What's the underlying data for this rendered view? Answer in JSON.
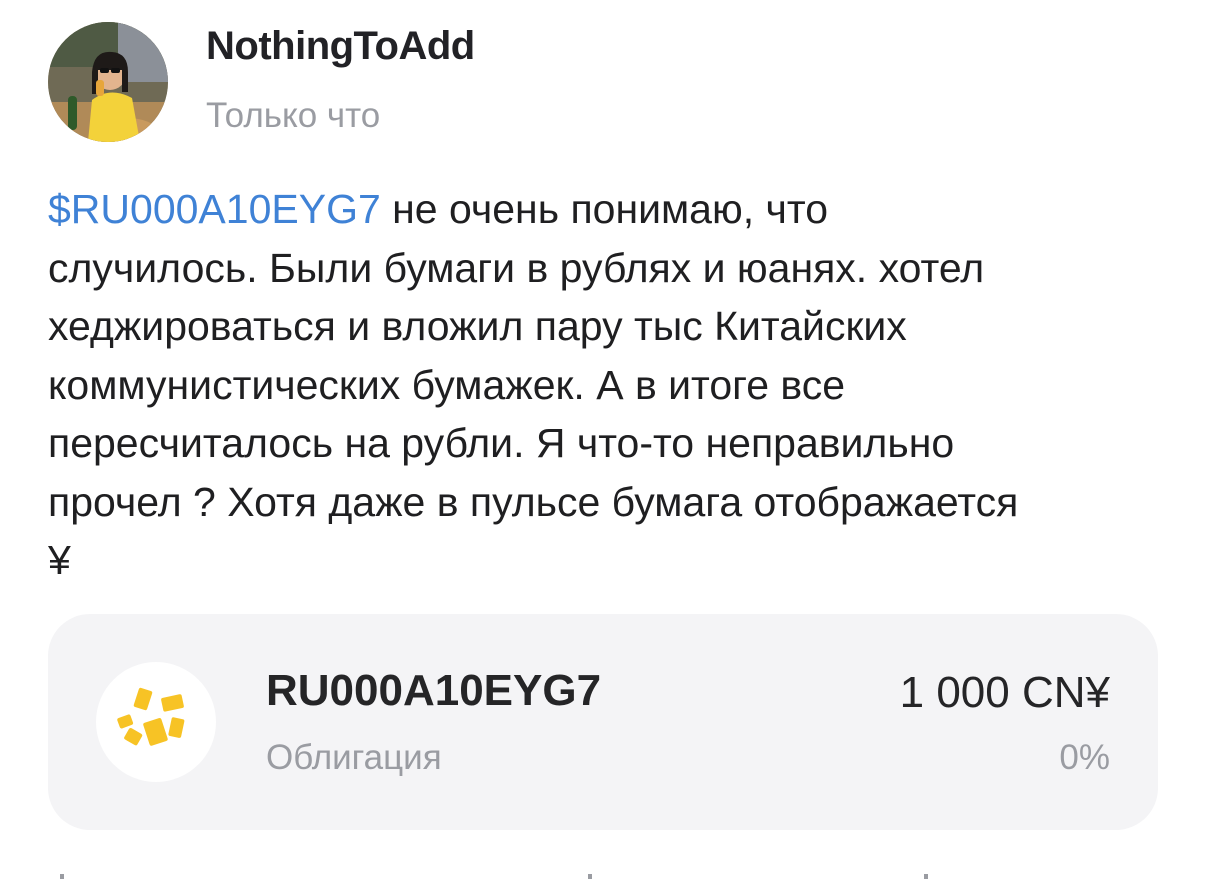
{
  "post": {
    "author": {
      "name": "NothingToAdd",
      "avatar": "user-avatar-photo"
    },
    "time": "Только что",
    "ticker_link": "$RU000A10EYG7",
    "text_lines": [
      " не очень понимаю, что",
      "случилось. Были бумаги в рублях и юанях.  хотел",
      "хеджироваться и вложил пару тыс Китайских",
      "коммунистических бумажек. А в итоге все",
      "пересчиталось на рубли. Я что-то неправильно",
      "прочел ? Хотя даже в пульсе бумага отображается",
      "¥"
    ]
  },
  "instrument_card": {
    "ticker": "RU000A10EYG7",
    "type": "Облигация",
    "price": "1 000 CN¥",
    "change": "0%",
    "logo_icon": "yellow-squares-logo-icon"
  },
  "colors": {
    "link": "#3f82d6",
    "text": "#1f1f21",
    "muted": "#9a9ca2",
    "card_bg": "#f4f4f6",
    "logo_yellow": "#f7c325"
  }
}
